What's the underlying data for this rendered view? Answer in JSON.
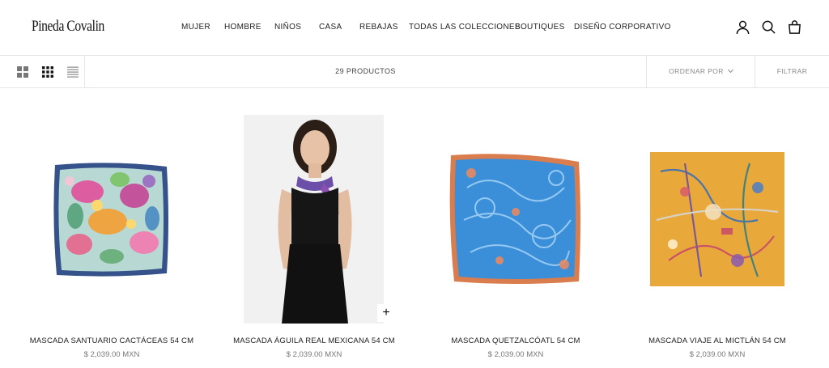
{
  "brand": {
    "logo": "Pineda Covalin"
  },
  "nav": {
    "items": [
      "MUJER",
      "HOMBRE",
      "NIÑOS",
      "CASA",
      "REBAJAS",
      "TODAS LAS COLECCIONES",
      "BOUTIQUES",
      "DISEÑO CORPORATIVO"
    ]
  },
  "header_icons": [
    "account-icon",
    "search-icon",
    "cart-icon"
  ],
  "toolbar": {
    "view_icons": [
      "grid-large-icon",
      "grid-small-icon",
      "list-icon"
    ],
    "count": "29 PRODUCTOS",
    "sort_label": "ORDENAR POR",
    "filter_label": "FILTRAR"
  },
  "products": [
    {
      "name": "MASCADA SANTUARIO CACTÁCEAS 54 CM",
      "price": "$ 2,039.00 MXN"
    },
    {
      "name": "MASCADA ÁGUILA REAL MEXICANA 54 CM",
      "price": "$ 2,039.00 MXN",
      "quick_add": "+"
    },
    {
      "name": "MASCADA QUETZALCÓATL 54 CM",
      "price": "$ 2,039.00 MXN"
    },
    {
      "name": "MASCADA VIAJE AL MICTLÁN 54 CM",
      "price": "$ 2,039.00 MXN"
    }
  ],
  "colors": {
    "border": "#e6e6e6",
    "text": "#1a1a1a",
    "muted": "#777777"
  }
}
